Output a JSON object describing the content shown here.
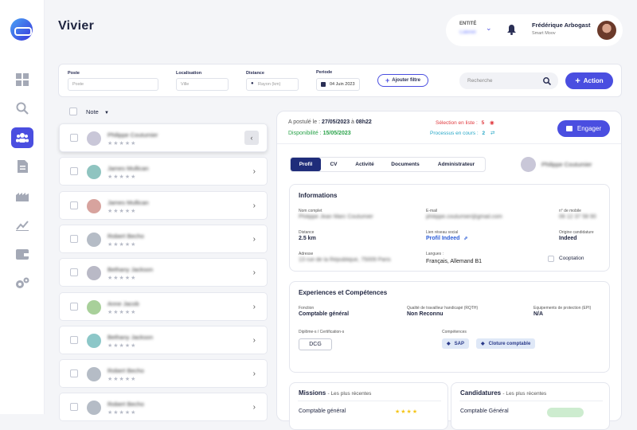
{
  "page": {
    "title": "Vivier"
  },
  "header": {
    "entite_label": "ENTITÉ",
    "entite_value": "Cabinet",
    "user_name": "Frédérique Arbogast",
    "user_company": "Smart Moov"
  },
  "filters": {
    "poste_label": "Poste",
    "poste_placeholder": "Poste",
    "localisation_label": "Localisation",
    "localisation_placeholder": "Ville",
    "distance_label": "Distance",
    "distance_placeholder": "Rayon (km)",
    "periode_label": "Periode",
    "periode_value": "04 Juin 2023",
    "add_filter": "Ajouter filtre",
    "search_placeholder": "Recherche",
    "action": "Action"
  },
  "list": {
    "sort_label": "Note",
    "candidates": [
      {
        "name": "Philippe Coutumier",
        "color": "#c9c7d8"
      },
      {
        "name": "James Mullican",
        "color": "#8fc4c0"
      },
      {
        "name": "James Mullican",
        "color": "#d7a39e"
      },
      {
        "name": "Robert Becho",
        "color": "#b5bcc6"
      },
      {
        "name": "Bethany Jackson",
        "color": "#b9b9c6"
      },
      {
        "name": "Anne Jacob",
        "color": "#a8d09a"
      },
      {
        "name": "Bethany Jackson",
        "color": "#8cc7c8"
      },
      {
        "name": "Robert Becho",
        "color": "#b5bcc6"
      },
      {
        "name": "Robert Becho",
        "color": "#b5bcc6"
      }
    ]
  },
  "detail": {
    "applied_label": "A postulé le :",
    "applied_date": "27/05/2023",
    "applied_at": "à",
    "applied_time": "08h22",
    "dispo_label": "Disponibilité :",
    "dispo_date": "15/05/2023",
    "selection_label": "Sélection en liste :",
    "selection_count": "5",
    "process_label": "Processus en cours :",
    "process_count": "2",
    "engager": "Engager",
    "tabs": [
      "Profil",
      "CV",
      "Activité",
      "Documents",
      "Administrateur"
    ],
    "candidate_name": "Philippe Coutumier",
    "informations": {
      "title": "Informations",
      "nom_label": "Nom complet",
      "nom_value": "Philippe Jean Marc Coutumier",
      "email_label": "E-mail",
      "email_value": "philippe.coutumier@gmail.com",
      "mobile_label": "n° de mobile",
      "mobile_value": "06 12 37 58 90",
      "distance_label": "Distance",
      "distance_value": "2.5 km",
      "reseau_label": "Lien réseau social",
      "reseau_value": "Profil Indeed",
      "origine_label": "Origine candidature",
      "origine_value": "Indeed",
      "adresse_label": "Adresse",
      "adresse_value": "13 rue de la République, 75009 Paris",
      "langues_label": "Langues :",
      "langues_value": "Français, Allemand B1",
      "cooptation": "Cooptation"
    },
    "experiences": {
      "title": "Experiences et Compétences",
      "fonction_label": "Fonction",
      "fonction_value": "Comptable général",
      "rqth_label": "Qualité de travailleur handicapé (RQTH)",
      "rqth_value": "Non Reconnu",
      "epi_label": "Equipements de protection (EPI)",
      "epi_value": "N/A",
      "diplomes_label": "Diplôme-s / Certification-s",
      "diplome": "DCG",
      "competences_label": "Compétences",
      "competences": [
        "SAP",
        "Cloture comptable"
      ]
    },
    "missions": {
      "title": "Missions",
      "subtitle": "- Les plus récentes",
      "item": "Comptable général"
    },
    "candidatures": {
      "title": "Candidatures",
      "subtitle": "- Les plus récentes",
      "item": "Comptable Général"
    }
  }
}
